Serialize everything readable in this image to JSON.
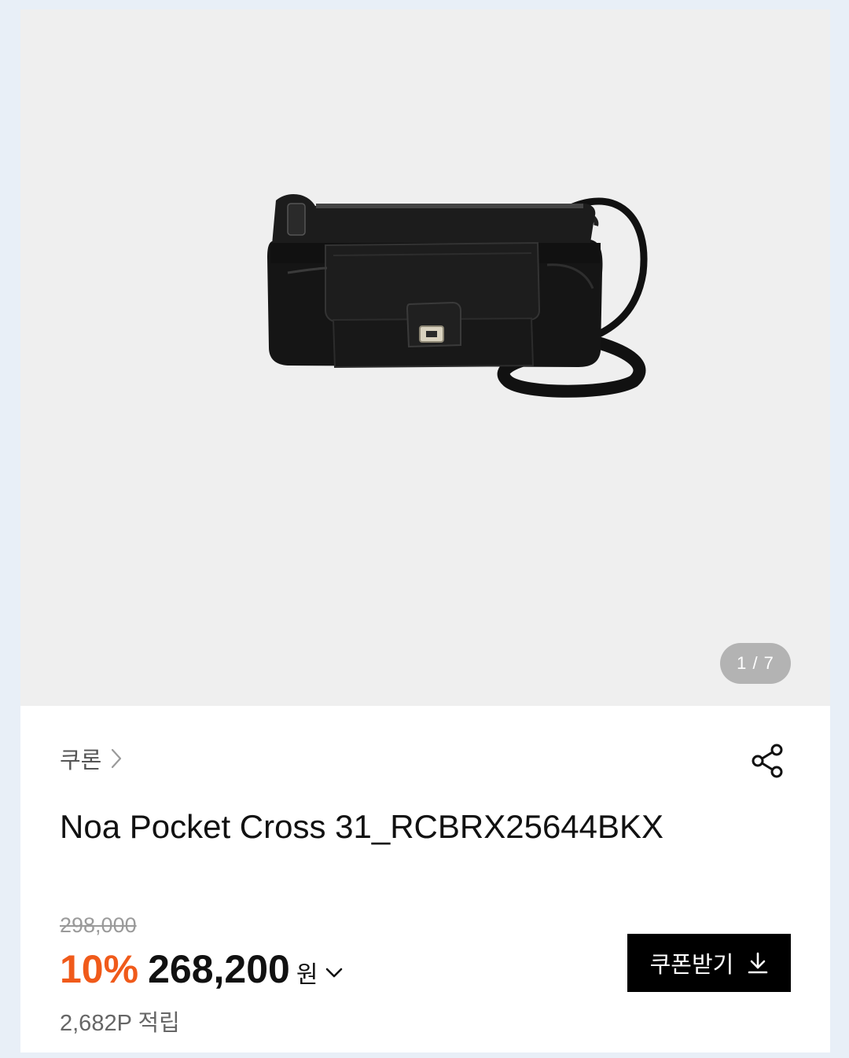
{
  "gallery": {
    "counter": "1 / 7"
  },
  "product": {
    "brand": "쿠론",
    "name": "Noa Pocket Cross 31_RCBRX25644BKX",
    "original_price": "298,000",
    "discount": "10%",
    "price": "268,200",
    "currency": "원",
    "points": "2,682P 적립"
  },
  "actions": {
    "coupon_label": "쿠폰받기"
  },
  "icons": {
    "brand_arrow": "chevron-right-icon",
    "share": "share-icon",
    "price_detail": "chevron-down-icon",
    "coupon_download": "download-icon"
  },
  "colors": {
    "discount": "#f05a1a",
    "coupon_button": "#000000",
    "gallery_background": "#efefef"
  }
}
